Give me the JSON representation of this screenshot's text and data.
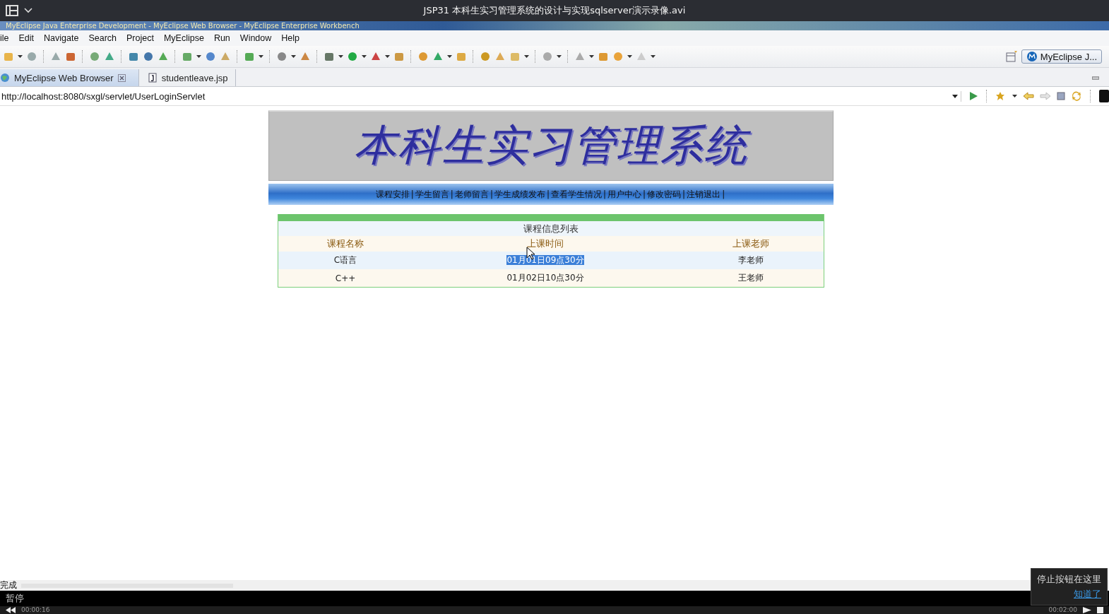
{
  "player": {
    "title": "JSP31 本科生实习管理系统的设计与实现sqlserver演示录像.avi",
    "state": "暂停",
    "elapsed": "00:00:16",
    "duration": "00:02:00",
    "tooltip": {
      "text": "停止按钮在这里",
      "link": "知道了"
    }
  },
  "eclipse": {
    "title": "MyEclipse Java Enterprise Development - MyEclipse Web Browser - MyEclipse Enterprise Workbench",
    "menu": [
      "ile",
      "Edit",
      "Navigate",
      "Search",
      "Project",
      "MyEclipse",
      "Run",
      "Window",
      "Help"
    ],
    "perspective": "MyEclipse J...",
    "tabs": [
      {
        "label": "MyEclipse Web Browser",
        "selected": true
      },
      {
        "label": "studentleave.jsp",
        "selected": false
      }
    ],
    "address": "http://localhost:8080/sxgl/servlet/UserLoginServlet",
    "status": "完成"
  },
  "page": {
    "banner": "本科生实习管理系统",
    "nav_separator": "|",
    "nav": [
      "课程安排",
      "学生留言",
      "老师留言",
      "学生成绩发布",
      "查看学生情况",
      "用户中心",
      "修改密码",
      "注销退出"
    ],
    "table": {
      "title": "课程信息列表",
      "columns": [
        "课程名称",
        "上课时间",
        "上课老师"
      ],
      "rows": [
        {
          "name": "C语言",
          "time": "01月01日09点30分",
          "teacher": "李老师",
          "time_highlighted": true
        },
        {
          "name": "C++",
          "time": "01月02日10点30分",
          "teacher": "王老师",
          "time_highlighted": false
        }
      ]
    }
  }
}
